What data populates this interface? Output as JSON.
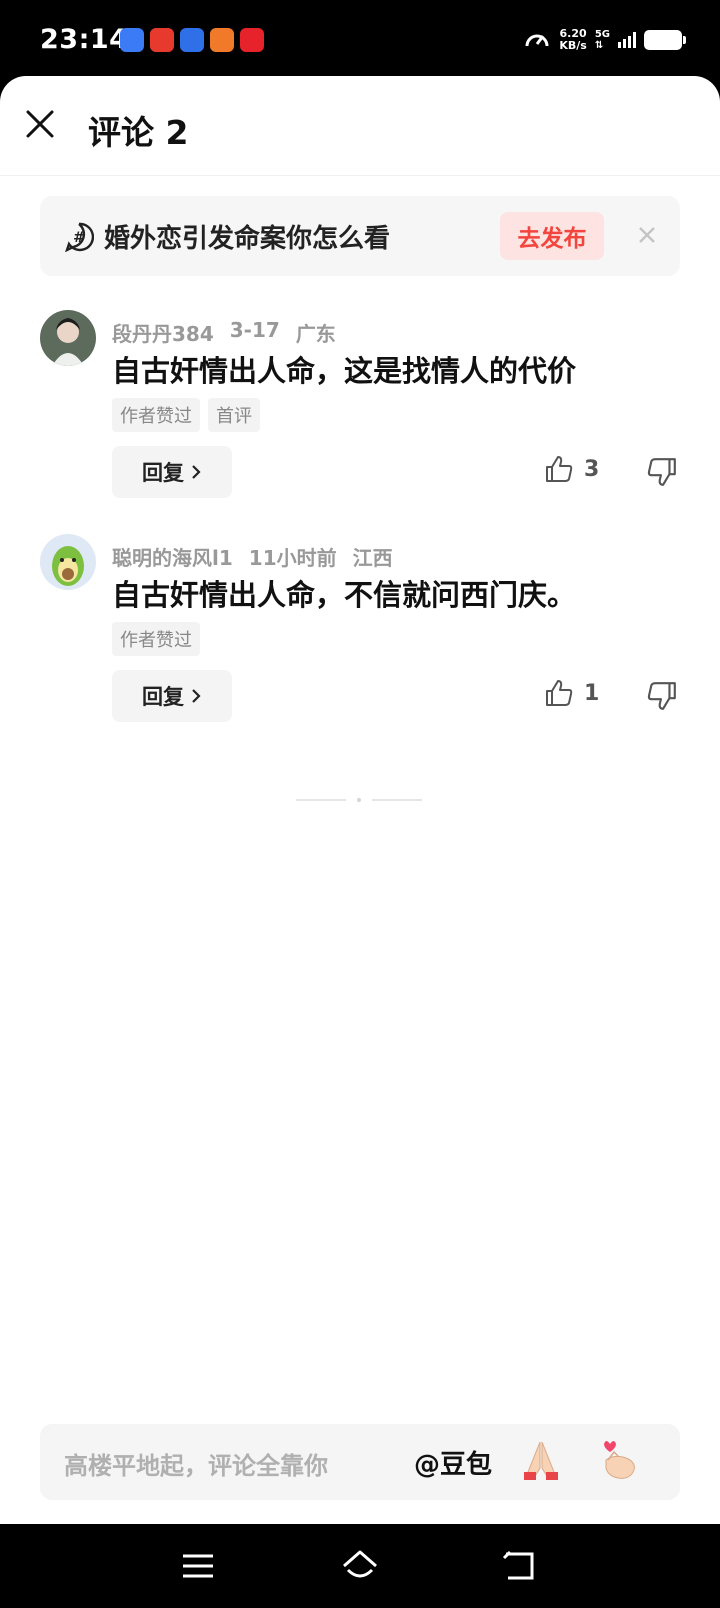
{
  "status_bar": {
    "time": "23:14",
    "speed_value": "6.20",
    "speed_unit": "KB/s",
    "network": "5G"
  },
  "header": {
    "title": "评论 2"
  },
  "topic": {
    "text": "婚外恋引发命案你怎么看",
    "button": "去发布"
  },
  "comments": [
    {
      "user": "段丹丹384",
      "date": "3-17",
      "location": "广东",
      "content": "自古奸情出人命，这是找情人的代价",
      "tags": [
        "作者赞过",
        "首评"
      ],
      "reply_label": "回复",
      "likes": "3"
    },
    {
      "user": "聪明的海风l1",
      "date": "11小时前",
      "location": "江西",
      "content": "自古奸情出人命，不信就问西门庆。",
      "tags": [
        "作者赞过"
      ],
      "reply_label": "回复",
      "likes": "1"
    }
  ],
  "input_bar": {
    "placeholder": "高楼平地起，评论全靠你",
    "at_label": "@豆包"
  },
  "colors": {
    "accent_red": "#f2453d",
    "publish_bg": "#fde3e1"
  }
}
